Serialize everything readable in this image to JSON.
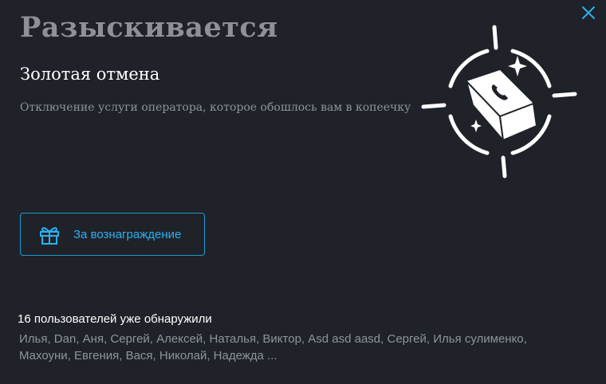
{
  "modal": {
    "section_title": "Разыскивается",
    "item_name": "Золотая отмена",
    "item_description": "Отключение услуги оператора, которое обошлось вам в копеечку",
    "illustration_icon": "crosshair-phone-gold-bar-icon",
    "close_icon": "close-icon"
  },
  "reward": {
    "label": "За вознаграждение",
    "icon": "gift-icon"
  },
  "found": {
    "count_text": "16 пользователей уже обнаружили",
    "users_line1": "Илья, Dan, Аня, Сергей, Алексей, Наталья, Виктор, Asd asd aasd, Сергей, Илья сулименко,",
    "users_line2": "Махоуни, Евгения, Вася, Николай, Надежда ..."
  },
  "colors": {
    "background": "#1f2229",
    "accent": "#2ab1f0",
    "muted_text": "#8f939b",
    "title_text": "#8e9198"
  }
}
